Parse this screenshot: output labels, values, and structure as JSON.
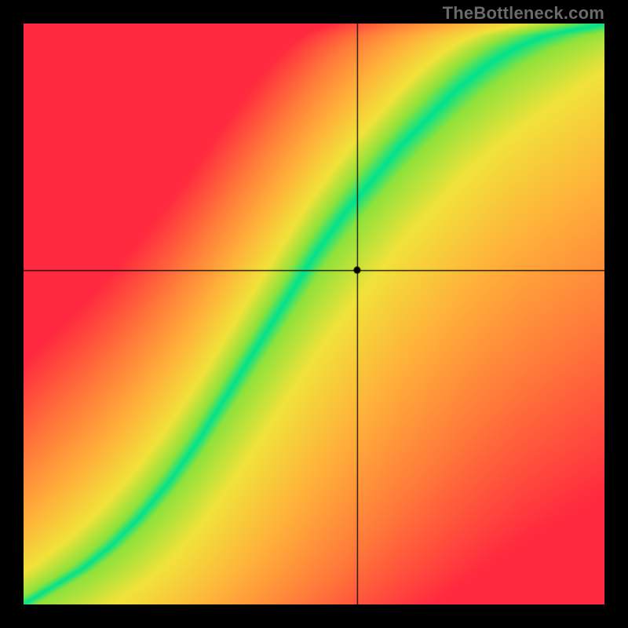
{
  "watermark": "TheBottleneck.com",
  "chart_data": {
    "type": "heatmap",
    "title": "",
    "xlabel": "",
    "ylabel": "",
    "xlim": [
      0,
      1
    ],
    "ylim": [
      0,
      1
    ],
    "grid": false,
    "curve_description": "Green optimal band follows a slightly S-shaped curve from bottom-left to top-right; colors transition green → yellow → orange → red with distance from the band.",
    "curve_points": [
      {
        "x": 0.0,
        "y": 0.0
      },
      {
        "x": 0.05,
        "y": 0.03
      },
      {
        "x": 0.1,
        "y": 0.06
      },
      {
        "x": 0.15,
        "y": 0.1
      },
      {
        "x": 0.2,
        "y": 0.15
      },
      {
        "x": 0.25,
        "y": 0.21
      },
      {
        "x": 0.3,
        "y": 0.28
      },
      {
        "x": 0.35,
        "y": 0.36
      },
      {
        "x": 0.4,
        "y": 0.44
      },
      {
        "x": 0.45,
        "y": 0.52
      },
      {
        "x": 0.5,
        "y": 0.6
      },
      {
        "x": 0.55,
        "y": 0.67
      },
      {
        "x": 0.6,
        "y": 0.73
      },
      {
        "x": 0.65,
        "y": 0.79
      },
      {
        "x": 0.7,
        "y": 0.84
      },
      {
        "x": 0.75,
        "y": 0.89
      },
      {
        "x": 0.8,
        "y": 0.93
      },
      {
        "x": 0.85,
        "y": 0.96
      },
      {
        "x": 0.9,
        "y": 0.98
      },
      {
        "x": 0.95,
        "y": 0.99
      },
      {
        "x": 1.0,
        "y": 1.0
      }
    ],
    "crosshair": {
      "x": 0.575,
      "y": 0.575
    },
    "marker": {
      "x": 0.575,
      "y": 0.575
    },
    "asymmetry_note": "Side above/left of the curve skews redder faster; side below/right stays orange/yellow longer.",
    "color_stops": [
      {
        "t": 0.0,
        "color": "#00e28f"
      },
      {
        "t": 0.12,
        "color": "#8ee23c"
      },
      {
        "t": 0.25,
        "color": "#f2e33a"
      },
      {
        "t": 0.45,
        "color": "#ffb43a"
      },
      {
        "t": 0.7,
        "color": "#ff7a3a"
      },
      {
        "t": 1.0,
        "color": "#ff2a3f"
      }
    ]
  }
}
